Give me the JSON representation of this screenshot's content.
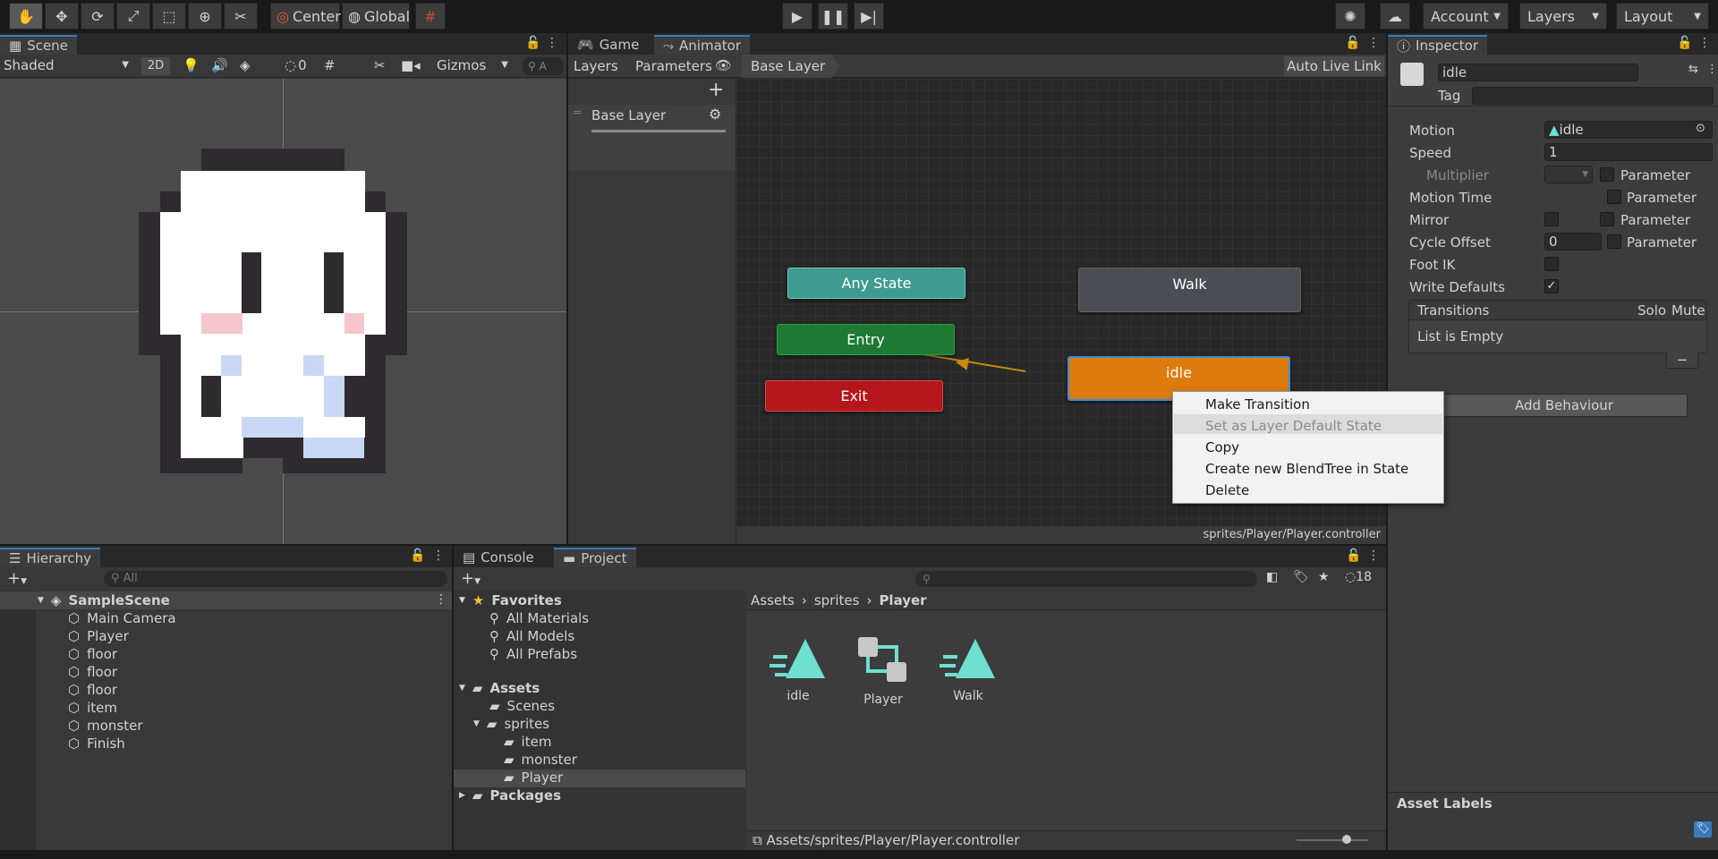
{
  "toolbar": {
    "pivot": "Center",
    "space": "Global",
    "account": "Account",
    "layers": "Layers",
    "layout": "Layout"
  },
  "scene": {
    "tab": "Scene",
    "shading": "Shaded",
    "mode2d": "2D",
    "hidden_count": "0",
    "gizmos": "Gizmos",
    "search_placeholder": "A"
  },
  "animator": {
    "tabs": [
      "Game",
      "Animator"
    ],
    "subtabs": [
      "Layers",
      "Parameters"
    ],
    "breadcrumb": "Base Layer",
    "auto_live_link": "Auto Live Link",
    "layer_name": "Base Layer",
    "nodes": {
      "any_state": "Any State",
      "entry": "Entry",
      "exit": "Exit",
      "walk": "Walk",
      "idle": "idle"
    },
    "status_path": "sprites/Player/Player.controller"
  },
  "context_menu": {
    "items": [
      "Make Transition",
      "Set as Layer Default State",
      "Copy",
      "Create new BlendTree in State",
      "Delete"
    ],
    "disabled": "Set as Layer Default State"
  },
  "inspector": {
    "tab": "Inspector",
    "name": "idle",
    "tag_label": "Tag",
    "motion_label": "Motion",
    "motion_value": "idle",
    "speed_label": "Speed",
    "speed_value": "1",
    "multiplier_label": "Multiplier",
    "parameter_label": "Parameter",
    "motion_time_label": "Motion Time",
    "mirror_label": "Mirror",
    "cycle_offset_label": "Cycle Offset",
    "cycle_offset_value": "0",
    "foot_ik_label": "Foot IK",
    "write_defaults_label": "Write Defaults",
    "transitions_label": "Transitions",
    "solo_label": "Solo",
    "mute_label": "Mute",
    "list_empty": "List is Empty",
    "minus": "−",
    "add_behaviour": "Add Behaviour",
    "asset_labels": "Asset Labels"
  },
  "hierarchy": {
    "tab": "Hierarchy",
    "search_placeholder": "All",
    "scene_name": "SampleScene",
    "items": [
      "Main Camera",
      "Player",
      "floor",
      "floor",
      "floor",
      "item",
      "monster",
      "Finish"
    ]
  },
  "project": {
    "tabs": [
      "Console",
      "Project"
    ],
    "hidden_count": "18",
    "favorites_label": "Favorites",
    "favorites": [
      "All Materials",
      "All Models",
      "All Prefabs"
    ],
    "assets_label": "Assets",
    "scenes": "Scenes",
    "sprites": "sprites",
    "sprite_children": [
      "item",
      "monster",
      "Player"
    ],
    "packages": "Packages",
    "breadcrumb": [
      "Assets",
      "sprites",
      "Player"
    ],
    "assets": [
      "idle",
      "Player",
      "Walk"
    ],
    "status_path": "Assets/sprites/Player/Player.controller"
  },
  "colors": {
    "any_state": "#3f9a8f",
    "entry": "#1e7a32",
    "exit": "#b5161b",
    "walk": "#4b4d52",
    "idle": "#de7b0e",
    "accent": "#3a79bb"
  }
}
